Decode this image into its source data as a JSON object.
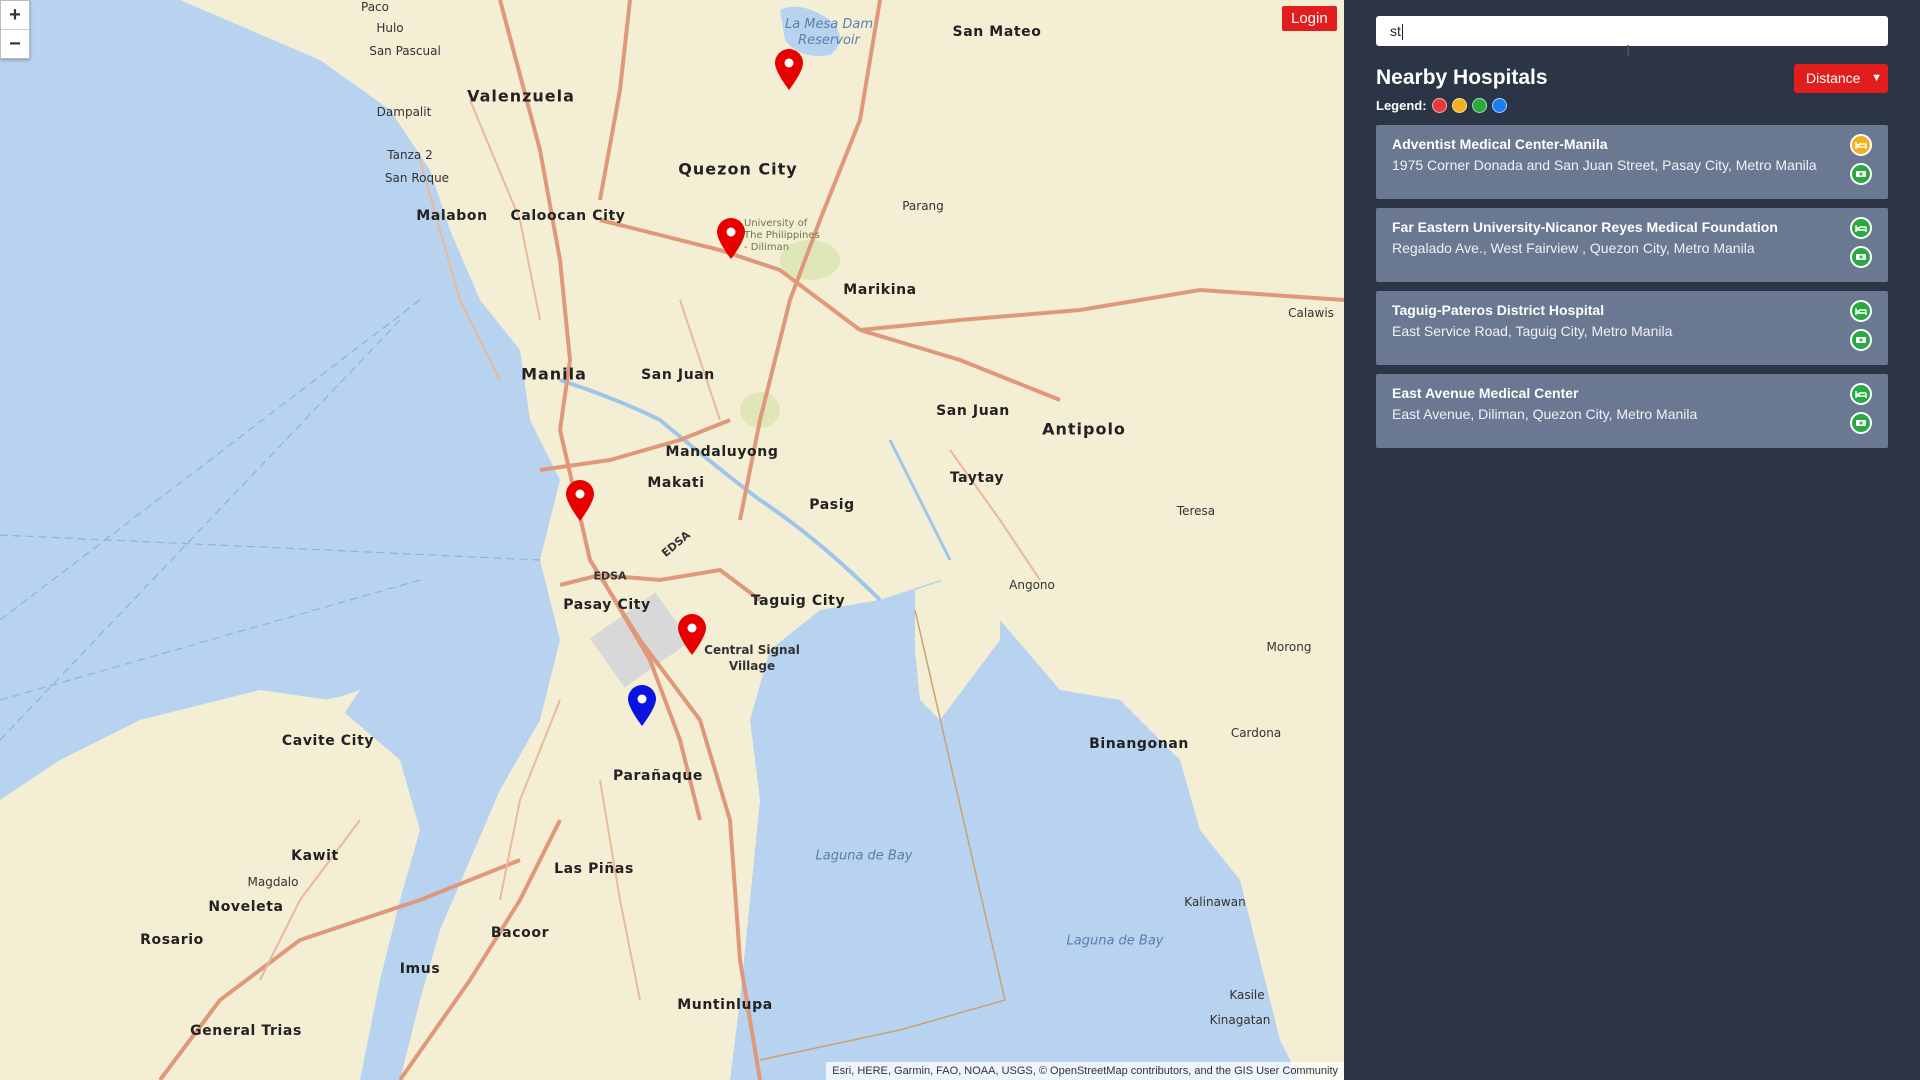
{
  "map": {
    "zoom_in": "+",
    "zoom_out": "−",
    "login_label": "Login",
    "attribution": "Esri, HERE, Garmin, FAO, NOAA, USGS, © OpenStreetMap contributors, and the GIS User Community",
    "places": {
      "paco": "Paco",
      "hulo": "Hulo",
      "san_pascual": "San Pascual",
      "dampalit": "Dampalit",
      "tanza2": "Tanza 2",
      "san_roque": "San Roque",
      "valenzuela": "Valenzuela",
      "malabon": "Malabon",
      "caloocan": "Caloocan City",
      "quezon": "Quezon City",
      "la_mesa": "La Mesa Dam Reservoir",
      "san_mateo": "San Mateo",
      "parang": "Parang",
      "up": "University of The Philippines - Diliman",
      "marikina": "Marikina",
      "calawis": "Calawis",
      "manila": "Manila",
      "san_juan": "San Juan",
      "san_juan_east": "San Juan",
      "antipolo": "Antipolo",
      "mandaluyong": "Mandaluyong",
      "makati": "Makati",
      "pasig": "Pasig",
      "taytay": "Taytay",
      "teresa": "Teresa",
      "pasay": "Pasay City",
      "taguig": "Taguig City",
      "angono": "Angono",
      "central_signal": "Central Signal Village",
      "morong": "Morong",
      "cavite": "Cavite City",
      "binangonan": "Binangonan",
      "cardona": "Cardona",
      "paranaque": "Parañaque",
      "kawit": "Kawit",
      "magdalo": "Magdalo",
      "noveleta": "Noveleta",
      "laguna1": "Laguna de Bay",
      "las_pinas": "Las Piñas",
      "kalinawan": "Kalinawan",
      "rosario": "Rosario",
      "laguna2": "Laguna de Bay",
      "bacoor": "Bacoor",
      "imus": "Imus",
      "kasile": "Kasile",
      "muntinlupa": "Muntinlupa",
      "kinagatan": "Kinagatan",
      "general_trias": "General Trias",
      "edsa1": "EDSA",
      "edsa2": "EDSA"
    },
    "colors": {
      "hospital_marker": "#e60000",
      "user_marker": "#0a14e0",
      "water": "#b7d3ef",
      "land": "#f4eed5"
    }
  },
  "sidebar": {
    "search": {
      "value": "st",
      "placeholder": ""
    },
    "title": "Nearby Hospitals",
    "sort": {
      "selected": "Distance"
    },
    "legend": {
      "label": "Legend:",
      "colors": [
        "#e83a3a",
        "#f2b21d",
        "#2aa842",
        "#1e7ef0"
      ]
    },
    "hospitals": [
      {
        "name": "Adventist Medical Center-Manila",
        "address": "1975 Corner Donada and San Juan Street, Pasay City, Metro Manila",
        "bed_icon": "bed-icon",
        "bed_color": "#f2b21d",
        "er_icon": "ambulance-icon",
        "er_color": "#2aa842"
      },
      {
        "name": "Far Eastern University-Nicanor Reyes Medical Foundation",
        "address": "Regalado Ave., West Fairview , Quezon City, Metro Manila",
        "bed_icon": "bed-icon",
        "bed_color": "#2aa842",
        "er_icon": "ambulance-icon",
        "er_color": "#2aa842"
      },
      {
        "name": "Taguig-Pateros District Hospital",
        "address": "East Service Road, Taguig City, Metro Manila",
        "bed_icon": "bed-icon",
        "bed_color": "#2aa842",
        "er_icon": "ambulance-icon",
        "er_color": "#2aa842"
      },
      {
        "name": "East Avenue Medical Center",
        "address": "East Avenue, Diliman, Quezon City, Metro Manila",
        "bed_icon": "bed-icon",
        "bed_color": "#2aa842",
        "er_icon": "ambulance-icon",
        "er_color": "#2aa842"
      }
    ]
  }
}
